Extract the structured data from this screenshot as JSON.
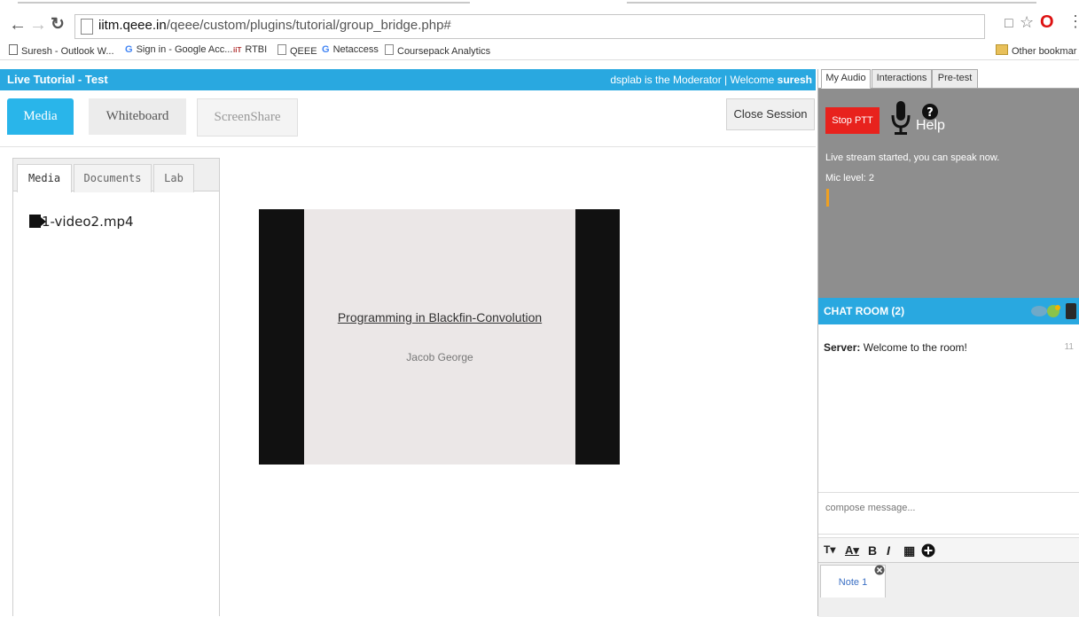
{
  "browser": {
    "url_host": "iitm.qeee.in",
    "url_path": "/qeee/custom/plugins/tutorial/group_bridge.php#",
    "bookmarks": [
      "Suresh - Outlook W...",
      "Sign in - Google Acc...",
      "RTBI",
      "QEEE",
      "Netaccess",
      "Coursepack Analytics"
    ],
    "other_bookmarks": "Other bookmar",
    "icons": [
      "back-icon",
      "forward-icon",
      "reload-icon",
      "page-icon",
      "star-icon",
      "opera-icon",
      "menu-icon",
      "folder-icon"
    ]
  },
  "app": {
    "title": "Live Tutorial - Test",
    "moderator_text": "dsplab is the Moderator | Welcome ",
    "username": "suresh",
    "accent": "#29a8e0"
  },
  "main_tabs": {
    "media": "Media",
    "whiteboard": "Whiteboard",
    "screenshare": "ScreenShare"
  },
  "close_session": "Close Session",
  "media_panel": {
    "tabs": {
      "media": "Media",
      "documents": "Documents",
      "lab": "Lab"
    },
    "files": [
      "1-video2.mp4"
    ]
  },
  "video": {
    "slide_title": "Programming in Blackfin-Convolution",
    "slide_author": "Jacob George"
  },
  "right_tabs": {
    "audio": "My Audio",
    "interactions": "Interactions",
    "pretest": "Pre-test"
  },
  "audio": {
    "stop_ptt": "Stop PTT",
    "help": "Help",
    "stream_message": "Live stream started, you can speak now.",
    "mic_level": "Mic level:  2",
    "stop_color": "#e8221d"
  },
  "chat": {
    "header": "CHAT ROOM (2)",
    "messages": [
      {
        "sender": "Server:",
        "text": "Welcome to the room!",
        "time": "11"
      }
    ],
    "compose_placeholder": "compose message..."
  },
  "notes": {
    "toolbar": [
      "font-size-icon",
      "font-color-icon",
      "bold-icon",
      "italic-icon",
      "save-icon",
      "add-icon"
    ],
    "tabs": [
      "Note 1"
    ]
  }
}
